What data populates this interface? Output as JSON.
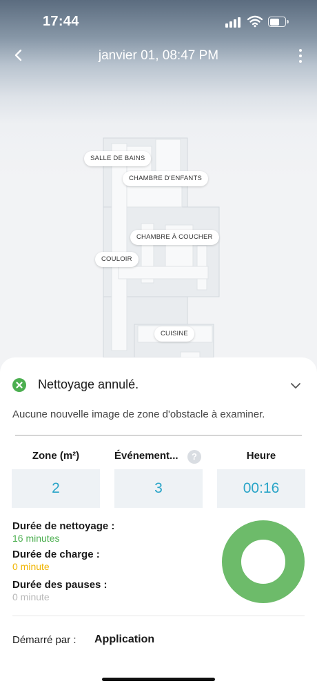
{
  "status_bar": {
    "time": "17:44"
  },
  "header": {
    "title": "janvier 01, 08:47 PM"
  },
  "map": {
    "rooms": [
      {
        "label": "SALLE DE BAINS"
      },
      {
        "label": "CHAMBRE D'ENFANTS"
      },
      {
        "label": "CHAMBRE À COUCHER"
      },
      {
        "label": "COULOIR"
      },
      {
        "label": "CUISINE"
      }
    ]
  },
  "summary": {
    "status": "Nettoyage annulé.",
    "info": "Aucune nouvelle image de zone d'obstacle à examiner.",
    "columns": [
      {
        "header": "Zone (m²)",
        "value": "2"
      },
      {
        "header": "Événement...",
        "value": "3"
      },
      {
        "header": "Heure",
        "value": "00:16"
      }
    ],
    "durations": [
      {
        "label": "Durée de nettoyage :",
        "value": "16 minutes",
        "color": "#4caf50"
      },
      {
        "label": "Durée de charge :",
        "value": "0 minute",
        "color": "#f0b400"
      },
      {
        "label": "Durée des pauses :",
        "value": "0 minute",
        "color": "#b8b8b8"
      }
    ],
    "started_by_label": "Démarré par :",
    "started_by_value": "Application"
  },
  "colors": {
    "accent": "#2aa5c8",
    "success": "#4caf50",
    "donut": "#6dbb6a"
  },
  "icons": [
    "back-icon",
    "more-icon",
    "success-icon",
    "chevron-down-icon",
    "help-icon"
  ]
}
